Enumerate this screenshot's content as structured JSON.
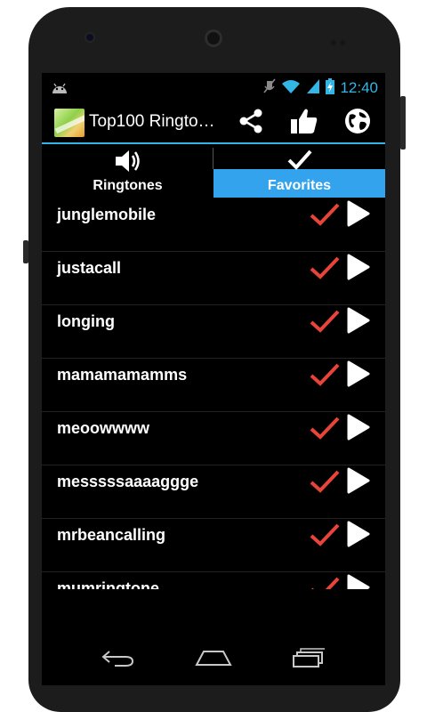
{
  "status_bar": {
    "time": "12:40",
    "icons": [
      "android-icon",
      "mute-icon",
      "wifi-icon",
      "signal-icon",
      "battery-charging-icon"
    ]
  },
  "action_bar": {
    "title": "Top100 Ringto…",
    "actions": [
      "share-icon",
      "thumbs-up-icon",
      "globe-icon"
    ]
  },
  "tabs": [
    {
      "label": "Ringtones",
      "icon": "speaker-icon",
      "selected": false
    },
    {
      "label": "Favorites",
      "icon": "checkmark-icon",
      "selected": true
    }
  ],
  "ringtones": [
    {
      "name": "junglemobile"
    },
    {
      "name": "justacall"
    },
    {
      "name": "longing"
    },
    {
      "name": "mamamamamms"
    },
    {
      "name": "meoowwww"
    },
    {
      "name": "messsssaaaaggge"
    },
    {
      "name": "mrbeancalling"
    },
    {
      "name": "mumringtone"
    }
  ],
  "colors": {
    "accent": "#33b5e5",
    "tab_selected": "#33a3ee",
    "favorite_check": "#e8443a",
    "background": "#000000"
  },
  "nav_bar": [
    "back-icon",
    "home-icon",
    "recent-apps-icon"
  ]
}
